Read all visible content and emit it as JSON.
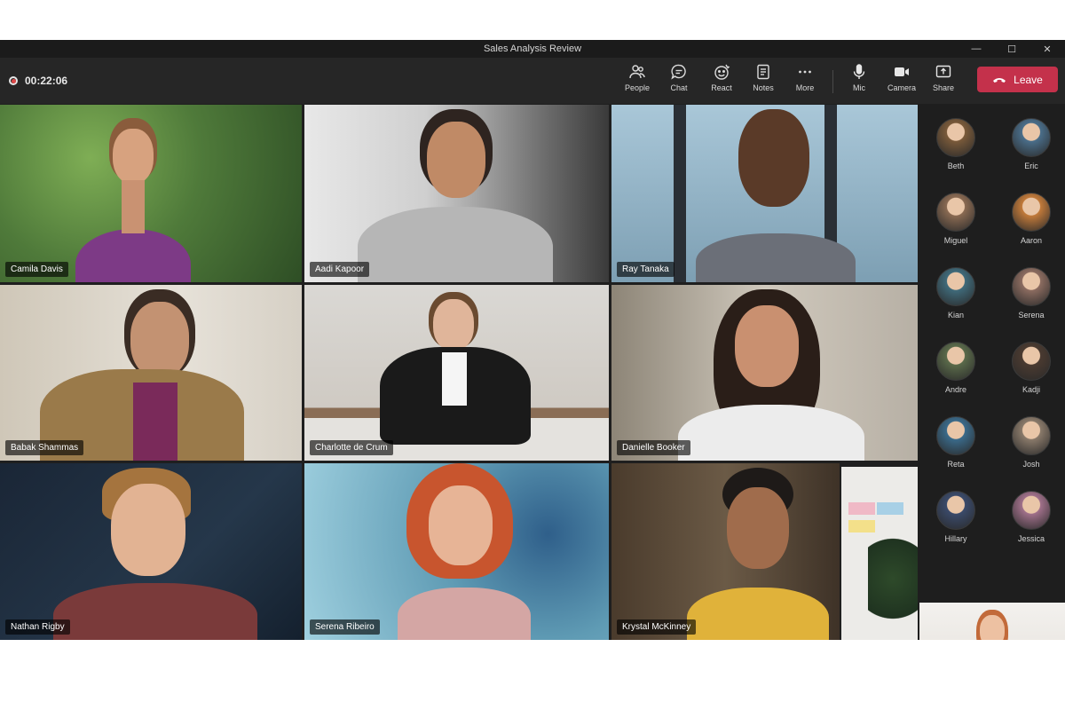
{
  "window": {
    "title": "Sales Analysis Review",
    "controls": [
      "—",
      "☐",
      "✕"
    ]
  },
  "toolbar": {
    "timer": "00:22:06",
    "buttons": [
      {
        "label": "People",
        "icon": "people-icon"
      },
      {
        "label": "Chat",
        "icon": "chat-icon"
      },
      {
        "label": "React",
        "icon": "react-icon"
      },
      {
        "label": "Notes",
        "icon": "notes-icon"
      },
      {
        "label": "More",
        "icon": "more-icon"
      },
      {
        "label": "Mic",
        "icon": "mic-icon"
      },
      {
        "label": "Camera",
        "icon": "camera-icon"
      },
      {
        "label": "Share",
        "icon": "share-icon"
      }
    ],
    "leave_label": "Leave"
  },
  "tiles": [
    {
      "name": "Camila Davis",
      "kind": "avatar",
      "bg": "#4f7a3a"
    },
    {
      "name": "Aadi Kapoor",
      "kind": "video",
      "bg": "#bcbcbc"
    },
    {
      "name": "Ray Tanaka",
      "kind": "avatar",
      "bg": "#8fb1c6"
    },
    {
      "name": "Babak Shammas",
      "kind": "video",
      "bg": "#d8d2c8"
    },
    {
      "name": "Charlotte de Crum",
      "kind": "video",
      "bg": "#d7d5d0"
    },
    {
      "name": "Danielle Booker",
      "kind": "video",
      "bg": "#c9c2b8"
    },
    {
      "name": "Nathan Rigby",
      "kind": "video",
      "bg": "#1d2a3a"
    },
    {
      "name": "Serena Ribeiro",
      "kind": "avatar",
      "bg": "#5f9bb4"
    },
    {
      "name": "Krystal McKinney",
      "kind": "avatar",
      "bg": "#6b5a46"
    }
  ],
  "attendees": [
    {
      "name": "Beth",
      "color": "#7a5a3a"
    },
    {
      "name": "Eric",
      "color": "#4a6e8a"
    },
    {
      "name": "Miguel",
      "color": "#8a6a52"
    },
    {
      "name": "Aaron",
      "color": "#c27a3a"
    },
    {
      "name": "Kian",
      "color": "#3f6a7a"
    },
    {
      "name": "Serena",
      "color": "#8c6c60"
    },
    {
      "name": "Andre",
      "color": "#5a6a4a"
    },
    {
      "name": "Kadji",
      "color": "#4a3a30"
    },
    {
      "name": "Reta",
      "color": "#3a6a8a"
    },
    {
      "name": "Josh",
      "color": "#8a7a6a"
    },
    {
      "name": "Hillary",
      "color": "#3a4a6a"
    },
    {
      "name": "Jessica",
      "color": "#a0708a"
    }
  ],
  "colors": {
    "leave": "#c4314b",
    "app_bg": "#1f1f1f",
    "toolbar_bg": "#262626"
  }
}
